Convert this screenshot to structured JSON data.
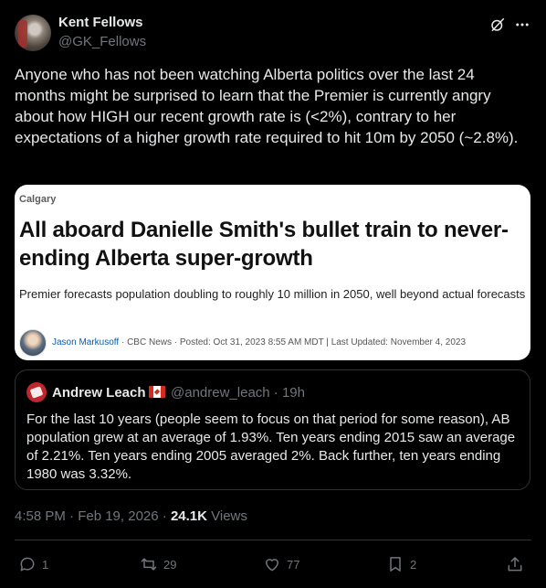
{
  "author": {
    "name": "Kent Fellows",
    "handle": "@GK_Fellows",
    "avatar_icon": "profile-photo"
  },
  "post": {
    "text": "Anyone who has not been watching Alberta politics over the last 24 months might be surprised to learn that the Premier is currently angry about how HIGH our recent growth rate is (<2%), contrary to her expectations of a higher growth rate required to hit 10m by 2050 (~2.8%)."
  },
  "link_card": {
    "section": "Calgary",
    "title": "All aboard Danielle Smith's bullet train to never-ending Alberta super-growth",
    "deck": "Premier forecasts population doubling to roughly 10 million in 2050, well beyond actual forecasts",
    "byline_author": "Jason Markusoff",
    "byline_rest": " · CBC News · Posted: Oct 31, 2023 8:55 AM MDT | Last Updated: November 4, 2023"
  },
  "quoted_post": {
    "name": "Andrew Leach",
    "handle_time": "@andrew_leach · 19h",
    "flag_icon": "canada-flag",
    "text": "For the last 10 years (people seem to focus on that period for some reason), AB population grew at an average of 1.93%.  Ten years ending 2015 saw an average of 2.21%. Ten years ending 2005 averaged 2%. Back further, ten years ending 1980 was 3.32%."
  },
  "meta": {
    "timestamp": "4:58 PM · Feb 19, 2026 · ",
    "views_count": "24.1K",
    "views_label": " Views"
  },
  "actions": {
    "replies": "1",
    "reposts": "29",
    "likes": "77",
    "bookmarks": "2"
  },
  "colors": {
    "background": "#000000",
    "text": "#e7e9ea",
    "muted": "#71767b",
    "border": "#2f3336",
    "card_link": "#0b5cad"
  }
}
